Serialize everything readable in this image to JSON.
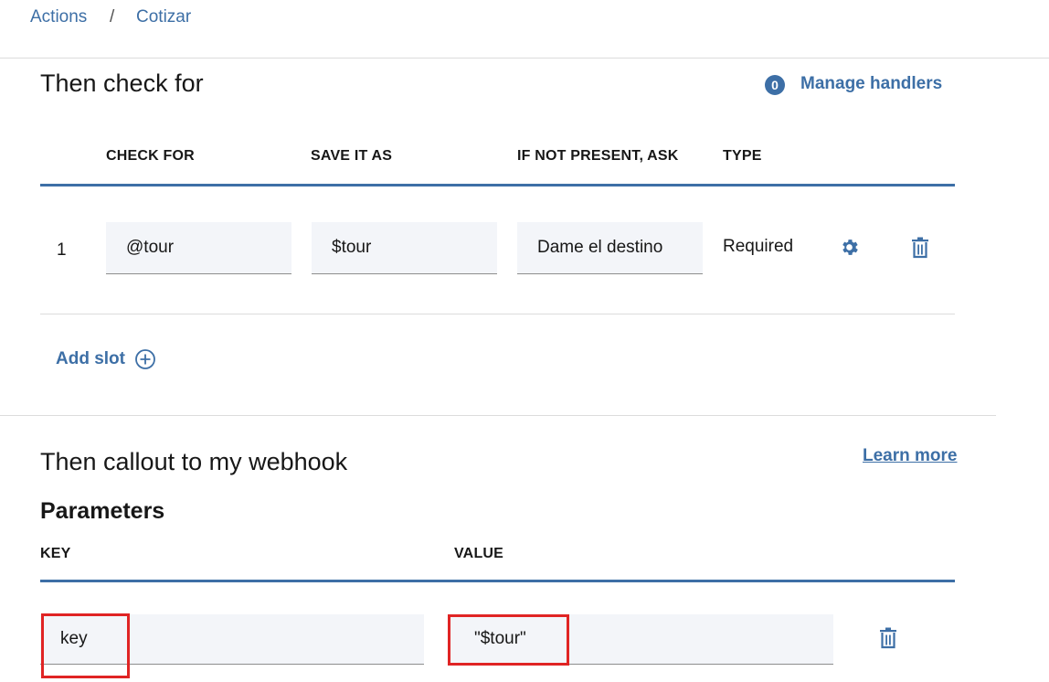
{
  "breadcrumb": {
    "parent": "Actions",
    "separator": "/",
    "current": "Cotizar"
  },
  "check_section": {
    "title": "Then check for",
    "handlers_count": "0",
    "manage_handlers_label": "Manage handlers",
    "columns": [
      "CHECK FOR",
      "SAVE IT AS",
      "IF NOT PRESENT, ASK",
      "TYPE"
    ],
    "rows": [
      {
        "index": "1",
        "check_for": "@tour",
        "save_as": "$tour",
        "ask": "Dame el destino",
        "type": "Required"
      }
    ],
    "add_slot_label": "Add slot"
  },
  "webhook_section": {
    "title": "Then callout to my webhook",
    "learn_more_label": "Learn more",
    "parameters_title": "Parameters",
    "columns": {
      "key": "KEY",
      "value": "VALUE"
    },
    "rows": [
      {
        "key": "key",
        "value": "\"$tour\""
      }
    ]
  },
  "colors": {
    "accent": "#3d6fa6",
    "highlight": "#e02424",
    "field_bg": "#f3f5f9"
  },
  "icons": {
    "settings": "gear-icon",
    "delete": "trash-icon",
    "add": "plus-circle-icon"
  }
}
